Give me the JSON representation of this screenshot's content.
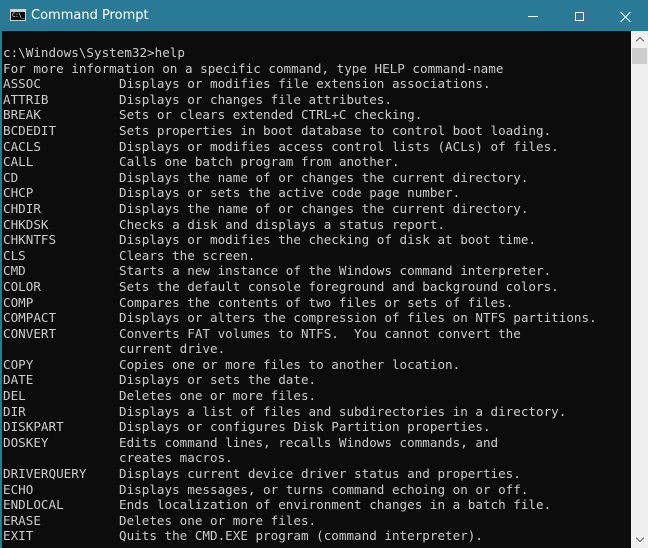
{
  "window": {
    "title": "Command Prompt",
    "icon": "console-icon",
    "icon_glyph": "C:\\_",
    "controls": {
      "minimize": "minimize-icon",
      "maximize": "maximize-icon",
      "close": "close-icon"
    }
  },
  "colors": {
    "titlebar": "#2b7a95",
    "console_bg": "#0c0c0c",
    "console_fg": "#cccccc",
    "scrollbar_track": "#f0f0f0",
    "scrollbar_thumb": "#cdcdcd"
  },
  "console": {
    "prompt_line": "c:\\Windows\\System32>help",
    "intro_line": "For more information on a specific command, type HELP command-name",
    "entries": [
      {
        "cmd": "ASSOC",
        "desc": "Displays or modifies file extension associations."
      },
      {
        "cmd": "ATTRIB",
        "desc": "Displays or changes file attributes."
      },
      {
        "cmd": "BREAK",
        "desc": "Sets or clears extended CTRL+C checking."
      },
      {
        "cmd": "BCDEDIT",
        "desc": "Sets properties in boot database to control boot loading."
      },
      {
        "cmd": "CACLS",
        "desc": "Displays or modifies access control lists (ACLs) of files."
      },
      {
        "cmd": "CALL",
        "desc": "Calls one batch program from another."
      },
      {
        "cmd": "CD",
        "desc": "Displays the name of or changes the current directory."
      },
      {
        "cmd": "CHCP",
        "desc": "Displays or sets the active code page number."
      },
      {
        "cmd": "CHDIR",
        "desc": "Displays the name of or changes the current directory."
      },
      {
        "cmd": "CHKDSK",
        "desc": "Checks a disk and displays a status report."
      },
      {
        "cmd": "CHKNTFS",
        "desc": "Displays or modifies the checking of disk at boot time."
      },
      {
        "cmd": "CLS",
        "desc": "Clears the screen."
      },
      {
        "cmd": "CMD",
        "desc": "Starts a new instance of the Windows command interpreter."
      },
      {
        "cmd": "COLOR",
        "desc": "Sets the default console foreground and background colors."
      },
      {
        "cmd": "COMP",
        "desc": "Compares the contents of two files or sets of files."
      },
      {
        "cmd": "COMPACT",
        "desc": "Displays or alters the compression of files on NTFS partitions."
      },
      {
        "cmd": "CONVERT",
        "desc": "Converts FAT volumes to NTFS.  You cannot convert the"
      },
      {
        "cmd": "",
        "desc": "current drive."
      },
      {
        "cmd": "COPY",
        "desc": "Copies one or more files to another location."
      },
      {
        "cmd": "DATE",
        "desc": "Displays or sets the date."
      },
      {
        "cmd": "DEL",
        "desc": "Deletes one or more files."
      },
      {
        "cmd": "DIR",
        "desc": "Displays a list of files and subdirectories in a directory."
      },
      {
        "cmd": "DISKPART",
        "desc": "Displays or configures Disk Partition properties."
      },
      {
        "cmd": "DOSKEY",
        "desc": "Edits command lines, recalls Windows commands, and"
      },
      {
        "cmd": "",
        "desc": "creates macros."
      },
      {
        "cmd": "DRIVERQUERY",
        "desc": "Displays current device driver status and properties."
      },
      {
        "cmd": "ECHO",
        "desc": "Displays messages, or turns command echoing on or off."
      },
      {
        "cmd": "ENDLOCAL",
        "desc": "Ends localization of environment changes in a batch file."
      },
      {
        "cmd": "ERASE",
        "desc": "Deletes one or more files."
      },
      {
        "cmd": "EXIT",
        "desc": "Quits the CMD.EXE program (command interpreter)."
      }
    ]
  },
  "scrollbar": {
    "up_icon": "chevron-up-icon",
    "down_icon": "chevron-down-icon",
    "position_fraction": 0.0
  }
}
